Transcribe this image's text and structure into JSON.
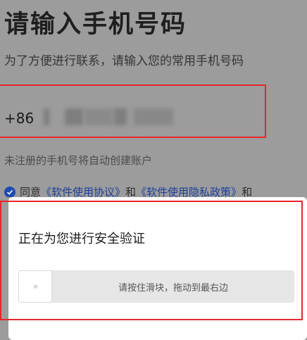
{
  "page": {
    "title": "请输入手机号码",
    "subtitle": "为了方便进行联系，请输入您的常用手机号码",
    "country_code": "+86",
    "hint": "未注册的手机号将自动创建账户",
    "agreement": {
      "prefix": "同意",
      "terms_link": "《软件使用协议》",
      "and": "和",
      "privacy_link": "《软件使用隐私政策》",
      "suffix": "和"
    }
  },
  "verification_dialog": {
    "title": "正在为您进行安全验证",
    "slider_label": "请按住滑块，拖动到最右边",
    "handle_glyph": "»",
    "handle_icon": "double-chevron-right-icon"
  },
  "colors": {
    "highlight_border": "#e8262b",
    "link": "#1d3f9b",
    "check": "#1d4bb2"
  }
}
